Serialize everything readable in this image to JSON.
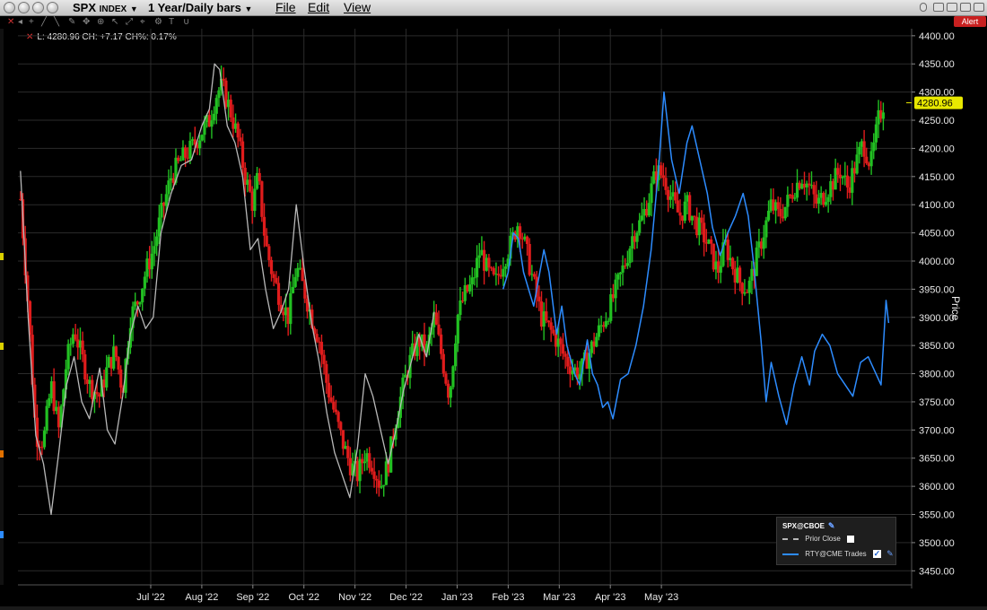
{
  "titlebar": {
    "symbol_main": "SPX",
    "symbol_sub": "INDEX",
    "period": "1 Year/Daily bars",
    "menus": [
      "File",
      "Edit",
      "View"
    ],
    "alert_label": "Alert"
  },
  "readout": "L: 4280.96 CH: +7.17 CH%: 0.17%",
  "colors": {
    "up": "#22c022",
    "down": "#e01c1c",
    "prior_close": "#b8b8b8",
    "rty": "#2d8cff",
    "grid": "#2b2b2b",
    "last_price_bg": "#e8e800"
  },
  "legend": {
    "title": "SPX@CBOE",
    "items": [
      {
        "label": "Prior Close",
        "style": "dashed",
        "checked": false
      },
      {
        "label": "RTY@CME Trades",
        "style": "solid",
        "checked": true
      }
    ]
  },
  "chart_data": {
    "type": "line",
    "ylabel": "Price",
    "ylim": [
      3425,
      4412.5
    ],
    "yticks": [
      3450,
      3500,
      3550,
      3600,
      3650,
      3700,
      3750,
      3800,
      3850,
      3900,
      3950,
      4000,
      4050,
      4100,
      4150,
      4200,
      4250,
      4300,
      4350,
      4400
    ],
    "ytick_labels": [
      "3450.00",
      "3500.00",
      "3550.00",
      "3600.00",
      "3650.00",
      "3700.00",
      "3750.00",
      "3800.00",
      "3850.00",
      "3900.00",
      "3950.00",
      "4000.00",
      "4050.00",
      "4100.00",
      "4150.00",
      "4200.00",
      "4250.00",
      "4300.00",
      "4350.00",
      "4400.00"
    ],
    "xlim": [
      -1.6,
      15.9
    ],
    "x_tick_positions": [
      1.0,
      2.0,
      3.0,
      4.0,
      5.0,
      6.0,
      7.0,
      8.0,
      9.0,
      10.0,
      11.0
    ],
    "x_tick_labels": [
      "Jul '22",
      "Aug '22",
      "Sep '22",
      "Oct '22",
      "Nov '22",
      "Dec '22",
      "Jan '23",
      "Feb '23",
      "Mar '23",
      "Apr '23",
      "May '23"
    ],
    "last_price": 4280.96,
    "last_price_label": "4280.96",
    "ohlc_note": "SPX daily OHLC bars, green = up, red = down",
    "spx_close_path": [
      [
        -1.55,
        4110
      ],
      [
        -1.4,
        3920
      ],
      [
        -1.25,
        3690
      ],
      [
        -1.1,
        3680
      ],
      [
        -0.95,
        3780
      ],
      [
        -0.8,
        3700
      ],
      [
        -0.65,
        3820
      ],
      [
        -0.5,
        3880
      ],
      [
        -0.35,
        3830
      ],
      [
        -0.2,
        3780
      ],
      [
        0.0,
        3760
      ],
      [
        0.15,
        3810
      ],
      [
        0.3,
        3840
      ],
      [
        0.45,
        3770
      ],
      [
        0.6,
        3900
      ],
      [
        0.75,
        3930
      ],
      [
        0.9,
        3980
      ],
      [
        1.05,
        4020
      ],
      [
        1.2,
        4080
      ],
      [
        1.4,
        4150
      ],
      [
        1.6,
        4180
      ],
      [
        1.8,
        4200
      ],
      [
        2.0,
        4230
      ],
      [
        2.15,
        4250
      ],
      [
        2.3,
        4300
      ],
      [
        2.4,
        4310
      ],
      [
        2.55,
        4270
      ],
      [
        2.7,
        4220
      ],
      [
        2.85,
        4150
      ],
      [
        3.0,
        4100
      ],
      [
        3.1,
        4150
      ],
      [
        3.25,
        4030
      ],
      [
        3.4,
        3970
      ],
      [
        3.55,
        3930
      ],
      [
        3.7,
        3900
      ],
      [
        3.85,
        3990
      ],
      [
        4.0,
        3950
      ],
      [
        4.15,
        3900
      ],
      [
        4.3,
        3860
      ],
      [
        4.45,
        3780
      ],
      [
        4.6,
        3730
      ],
      [
        4.75,
        3680
      ],
      [
        4.9,
        3640
      ],
      [
        5.05,
        3620
      ],
      [
        5.2,
        3660
      ],
      [
        5.35,
        3640
      ],
      [
        5.5,
        3600
      ],
      [
        5.65,
        3640
      ],
      [
        5.8,
        3720
      ],
      [
        5.95,
        3780
      ],
      [
        6.1,
        3830
      ],
      [
        6.25,
        3860
      ],
      [
        6.4,
        3840
      ],
      [
        6.55,
        3900
      ],
      [
        6.7,
        3830
      ],
      [
        6.85,
        3760
      ],
      [
        7.0,
        3900
      ],
      [
        7.15,
        3940
      ],
      [
        7.3,
        3960
      ],
      [
        7.45,
        4020
      ],
      [
        7.6,
        3980
      ],
      [
        7.75,
        3960
      ],
      [
        7.9,
        4000
      ],
      [
        8.05,
        4030
      ],
      [
        8.2,
        4070
      ],
      [
        8.35,
        4020
      ],
      [
        8.5,
        3960
      ],
      [
        8.65,
        3900
      ],
      [
        8.8,
        3880
      ],
      [
        8.95,
        3860
      ],
      [
        9.1,
        3830
      ],
      [
        9.25,
        3810
      ],
      [
        9.4,
        3800
      ],
      [
        9.55,
        3830
      ],
      [
        9.7,
        3860
      ],
      [
        9.85,
        3890
      ],
      [
        10.0,
        3920
      ],
      [
        10.15,
        3960
      ],
      [
        10.3,
        4000
      ],
      [
        10.45,
        4050
      ],
      [
        10.6,
        4070
      ],
      [
        10.75,
        4110
      ],
      [
        10.9,
        4160
      ],
      [
        11.05,
        4150
      ],
      [
        11.2,
        4110
      ],
      [
        11.35,
        4080
      ],
      [
        11.5,
        4100
      ],
      [
        11.65,
        4070
      ],
      [
        11.8,
        4050
      ],
      [
        11.95,
        4020
      ],
      [
        12.1,
        3980
      ],
      [
        12.25,
        4030
      ],
      [
        12.4,
        3990
      ],
      [
        12.55,
        3960
      ],
      [
        12.7,
        3950
      ],
      [
        12.85,
        4000
      ],
      [
        13.0,
        4050
      ],
      [
        13.15,
        4100
      ],
      [
        13.3,
        4080
      ],
      [
        13.45,
        4100
      ],
      [
        13.6,
        4130
      ],
      [
        13.75,
        4150
      ],
      [
        13.9,
        4130
      ],
      [
        14.05,
        4100
      ],
      [
        14.2,
        4120
      ],
      [
        14.35,
        4140
      ],
      [
        14.5,
        4160
      ],
      [
        14.65,
        4130
      ],
      [
        14.8,
        4170
      ],
      [
        14.95,
        4210
      ],
      [
        15.1,
        4170
      ],
      [
        15.25,
        4250
      ],
      [
        15.35,
        4281
      ]
    ],
    "series": [
      {
        "name": "Prior Close",
        "values": [
          [
            -1.55,
            4160
          ],
          [
            -1.4,
            3900
          ],
          [
            -1.25,
            3690
          ],
          [
            -1.1,
            3640
          ],
          [
            -0.95,
            3550
          ],
          [
            -0.8,
            3660
          ],
          [
            -0.65,
            3780
          ],
          [
            -0.5,
            3830
          ],
          [
            -0.35,
            3750
          ],
          [
            -0.2,
            3720
          ],
          [
            0.0,
            3810
          ],
          [
            0.15,
            3700
          ],
          [
            0.3,
            3675
          ],
          [
            0.45,
            3760
          ],
          [
            0.6,
            3870
          ],
          [
            0.75,
            3920
          ],
          [
            0.9,
            3880
          ],
          [
            1.05,
            3900
          ],
          [
            1.2,
            4050
          ],
          [
            1.4,
            4120
          ],
          [
            1.6,
            4170
          ],
          [
            1.8,
            4180
          ],
          [
            2.0,
            4240
          ],
          [
            2.15,
            4270
          ],
          [
            2.25,
            4350
          ],
          [
            2.35,
            4340
          ],
          [
            2.5,
            4240
          ],
          [
            2.65,
            4210
          ],
          [
            2.8,
            4150
          ],
          [
            2.95,
            4020
          ],
          [
            3.1,
            4040
          ],
          [
            3.25,
            3950
          ],
          [
            3.4,
            3880
          ],
          [
            3.55,
            3910
          ],
          [
            3.7,
            3950
          ],
          [
            3.85,
            4100
          ],
          [
            4.0,
            3990
          ],
          [
            4.15,
            3890
          ],
          [
            4.3,
            3820
          ],
          [
            4.45,
            3730
          ],
          [
            4.6,
            3660
          ],
          [
            4.75,
            3620
          ],
          [
            4.9,
            3580
          ],
          [
            5.05,
            3670
          ],
          [
            5.2,
            3800
          ],
          [
            5.35,
            3760
          ],
          [
            5.5,
            3700
          ],
          [
            5.65,
            3640
          ],
          [
            5.8,
            3700
          ],
          [
            5.95,
            3770
          ],
          [
            6.1,
            3820
          ],
          [
            6.25,
            3870
          ],
          [
            6.4,
            3830
          ],
          [
            6.55,
            3910
          ]
        ]
      },
      {
        "name": "RTY@CME Trades",
        "values": [
          [
            7.9,
            3950
          ],
          [
            8.0,
            3980
          ],
          [
            8.1,
            4050
          ],
          [
            8.2,
            4040
          ],
          [
            8.3,
            3980
          ],
          [
            8.4,
            3950
          ],
          [
            8.5,
            3920
          ],
          [
            8.6,
            3970
          ],
          [
            8.7,
            4020
          ],
          [
            8.8,
            3980
          ],
          [
            8.95,
            3870
          ],
          [
            9.05,
            3920
          ],
          [
            9.15,
            3850
          ],
          [
            9.3,
            3800
          ],
          [
            9.4,
            3780
          ],
          [
            9.55,
            3860
          ],
          [
            9.65,
            3800
          ],
          [
            9.75,
            3780
          ],
          [
            9.85,
            3740
          ],
          [
            9.95,
            3750
          ],
          [
            10.05,
            3720
          ],
          [
            10.2,
            3790
          ],
          [
            10.35,
            3800
          ],
          [
            10.5,
            3850
          ],
          [
            10.65,
            3920
          ],
          [
            10.8,
            4020
          ],
          [
            10.95,
            4170
          ],
          [
            11.05,
            4300
          ],
          [
            11.2,
            4180
          ],
          [
            11.35,
            4120
          ],
          [
            11.5,
            4210
          ],
          [
            11.6,
            4240
          ],
          [
            11.75,
            4180
          ],
          [
            11.9,
            4120
          ],
          [
            12.0,
            4060
          ],
          [
            12.15,
            4010
          ],
          [
            12.3,
            4050
          ],
          [
            12.45,
            4080
          ],
          [
            12.6,
            4120
          ],
          [
            12.7,
            4080
          ],
          [
            12.8,
            4000
          ],
          [
            12.95,
            3860
          ],
          [
            13.05,
            3750
          ],
          [
            13.15,
            3820
          ],
          [
            13.3,
            3760
          ],
          [
            13.45,
            3710
          ],
          [
            13.6,
            3780
          ],
          [
            13.75,
            3830
          ],
          [
            13.9,
            3780
          ],
          [
            14.0,
            3840
          ],
          [
            14.15,
            3870
          ],
          [
            14.3,
            3850
          ],
          [
            14.45,
            3800
          ],
          [
            14.6,
            3780
          ],
          [
            14.75,
            3760
          ],
          [
            14.9,
            3820
          ],
          [
            15.05,
            3830
          ],
          [
            15.2,
            3800
          ],
          [
            15.3,
            3780
          ],
          [
            15.4,
            3930
          ],
          [
            15.45,
            3890
          ]
        ]
      }
    ]
  }
}
